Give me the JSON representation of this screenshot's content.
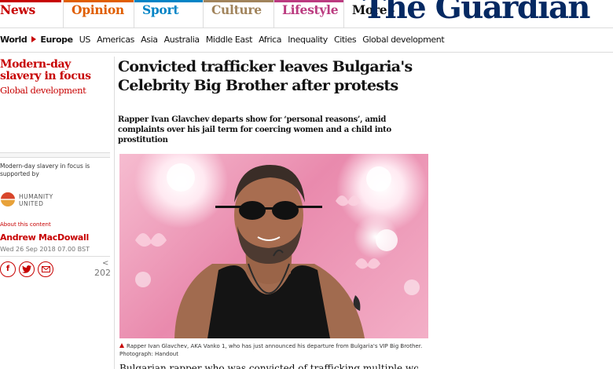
{
  "nav": {
    "pillars": [
      {
        "label": "News",
        "color": "#c70000"
      },
      {
        "label": "Opinion",
        "color": "#e05e00"
      },
      {
        "label": "Sport",
        "color": "#0084c6"
      },
      {
        "label": "Culture",
        "color": "#a1845c"
      },
      {
        "label": "Lifestyle",
        "color": "#bb3b80"
      }
    ],
    "more_label": "More",
    "logo": "The Guardian"
  },
  "subnav": {
    "items": [
      "World",
      "Europe",
      "US",
      "Americas",
      "Asia",
      "Australia",
      "Middle East",
      "Africa",
      "Inequality",
      "Cities",
      "Global development"
    ]
  },
  "sidebar": {
    "series_title": "Modern-day slavery in focus",
    "section": "Global development",
    "supported_text": "Modern-day slavery in focus is supported by",
    "sponsor_line1": "HUMANITY",
    "sponsor_line2": "UNITED",
    "about_link": "About this content",
    "author": "Andrew MacDowall",
    "date": "Wed 26 Sep 2018 07.00 BST",
    "share_icons": [
      "facebook-icon",
      "twitter-icon",
      "email-icon"
    ],
    "share_count": "202"
  },
  "article": {
    "headline": "Convicted trafficker leaves Bulgaria's Celebrity Big Brother after protests",
    "standfirst": "Rapper Ivan Glavchev departs show for ‘personal reasons’, amid complaints over his jail term for coercing women and a child into prostitution",
    "caption": "Rapper Ivan Glavchev, AKA Vanko 1, who has just announced his departure from Bulgaria's VIP Big Brother. Photograph: Handout",
    "body_first_line": "Bulgarian rapper who was convicted of trafficking multiple women and a"
  },
  "colors": {
    "brand": "#052962",
    "news_red": "#c70000"
  }
}
